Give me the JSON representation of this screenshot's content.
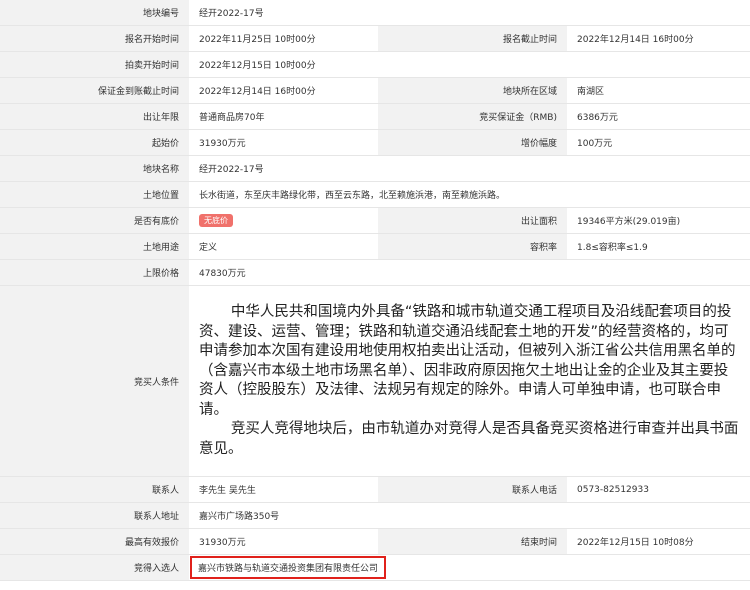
{
  "rows": {
    "r1": {
      "l1": "地块编号",
      "v1": "经开2022-17号"
    },
    "r2": {
      "l1": "报名开始时间",
      "v1": "2022年11月25日 10时00分",
      "l2": "报名截止时间",
      "v2": "2022年12月14日 16时00分"
    },
    "r3": {
      "l1": "拍卖开始时间",
      "v1": "2022年12月15日 10时00分"
    },
    "r4": {
      "l1": "保证金到账截止时间",
      "v1": "2022年12月14日 16时00分",
      "l2": "地块所在区域",
      "v2": "南湖区"
    },
    "r5": {
      "l1": "出让年限",
      "v1": "普通商品房70年",
      "l2": "竞买保证金（RMB)",
      "v2": "6386万元"
    },
    "r6": {
      "l1": "起始价",
      "v1": "31930万元",
      "l2": "增价幅度",
      "v2": "100万元"
    },
    "r7": {
      "l1": "地块名称",
      "v1": "经开2022-17号"
    },
    "r8": {
      "l1": "土地位置",
      "v1": "长水街道，东至庆丰路绿化带，西至云东路，北至赖施浜港，南至赖施浜路。"
    },
    "r9": {
      "l1": "是否有底价",
      "badge": "无底价",
      "l2": "出让面积",
      "v2": "19346平方米(29.019亩)"
    },
    "r10": {
      "l1": "土地用途",
      "v1": "定义",
      "l2": "容积率",
      "v2": "1.8≤容积率≤1.9"
    },
    "r11": {
      "l1": "上限价格",
      "v1": "47830万元"
    },
    "cond": {
      "label": "竞买人条件",
      "p1": "中华人民共和国境内外具备“铁路和城市轨道交通工程项目及沿线配套项目的投资、建设、运营、管理；铁路和轨道交通沿线配套土地的开发”的经营资格的，均可申请参加本次国有建设用地使用权拍卖出让活动，但被列入浙江省公共信用黑名单的（含嘉兴市本级土地市场黑名单）、因非政府原因拖欠土地出让金的企业及其主要投资人（控股股东）及法律、法规另有规定的除外。申请人可单独申请，也可联合申请。",
      "p2": "竞买人竞得地块后，由市轨道办对竞得人是否具备竞买资格进行审查并出具书面意见。"
    },
    "r12": {
      "l1": "联系人",
      "v1": "李先生 吴先生",
      "l2": "联系人电话",
      "v2": "0573-82512933"
    },
    "r13": {
      "l1": "联系人地址",
      "v1": "嘉兴市广场路350号"
    },
    "r14": {
      "l1": "最高有效报价",
      "v1": "31930万元",
      "l2": "结束时间",
      "v2": "2022年12月15日 10时08分"
    },
    "r15": {
      "l1": "竞得入选人",
      "v1": "嘉兴市铁路与轨道交通投资集团有限责任公司"
    }
  },
  "colors": {
    "label_bg": "#f2f2f2",
    "highlight": "#e0211b",
    "badge": "#f0716b"
  }
}
